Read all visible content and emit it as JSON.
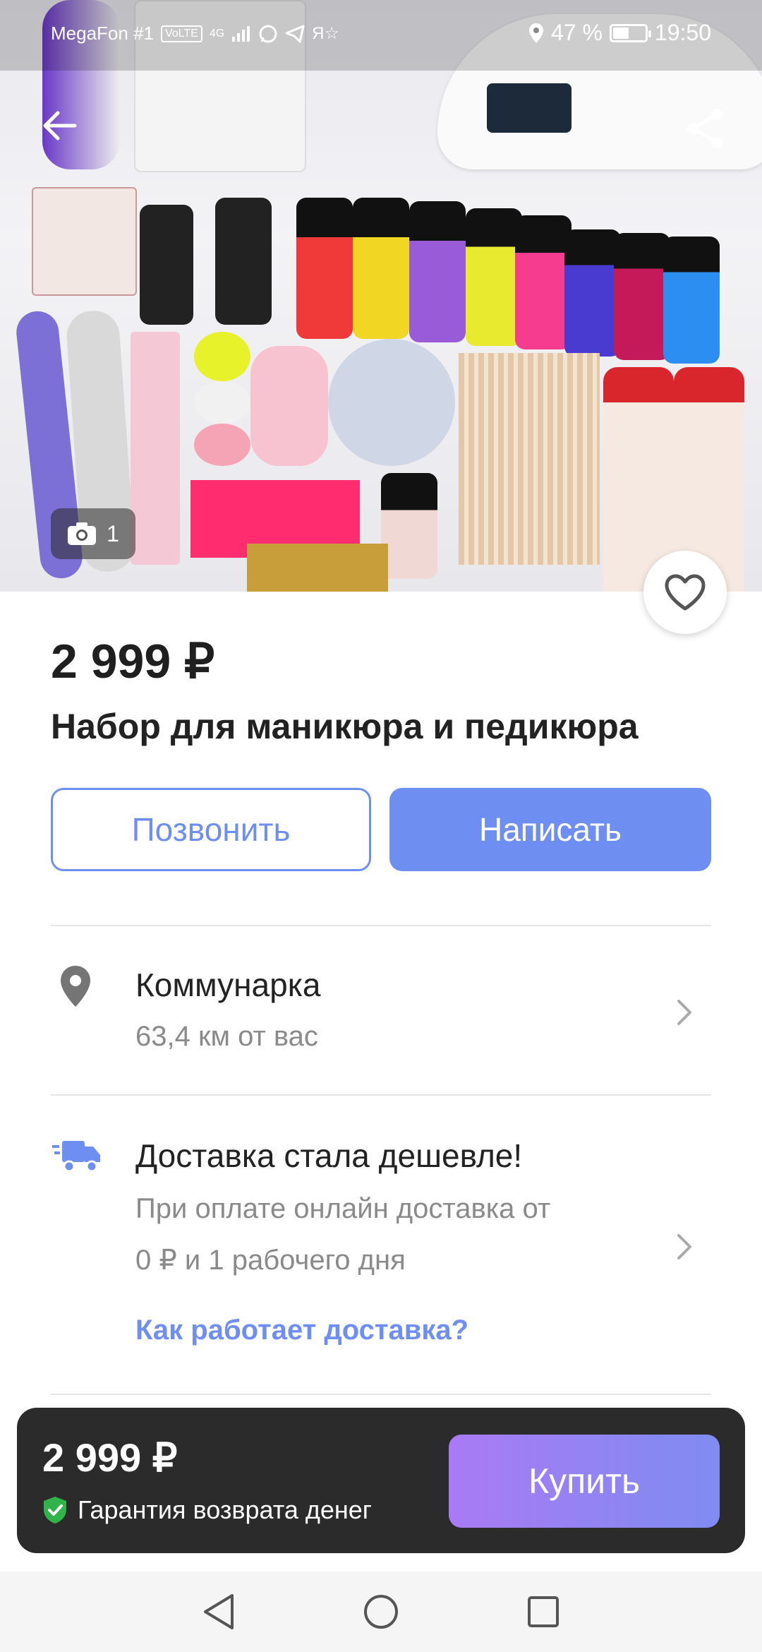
{
  "status_bar": {
    "carrier": "MegaFon #1",
    "volte": "VoLTE",
    "network": "4G",
    "battery_percent": "47 %",
    "battery_level": 0.47,
    "time": "19:50"
  },
  "photo": {
    "count": "1"
  },
  "listing": {
    "price": "2 999 ₽",
    "title": "Набор для маникюра и педикюра"
  },
  "actions": {
    "call_label": "Позвонить",
    "write_label": "Написать"
  },
  "location": {
    "name": "Коммунарка",
    "distance": "63,4 км от вас"
  },
  "delivery": {
    "title": "Доставка стала дешевле!",
    "line1": "При оплате онлайн доставка от",
    "line2": "0 ₽ и 1 рабочего дня",
    "link": "Как работает доставка?"
  },
  "buy_bar": {
    "price": "2 999 ₽",
    "guarantee": "Гарантия возврата денег",
    "buy_label": "Купить"
  },
  "colors": {
    "accent": "#6f8ef2",
    "buy_gradient_start": "#a97af5",
    "buy_gradient_end": "#7f8cf1",
    "bar_bg": "#2b2b2b",
    "guarantee_green": "#2fb34a"
  },
  "icons": {
    "back": "arrow-left-icon",
    "share": "share-icon",
    "camera": "camera-icon",
    "favorite": "heart-icon",
    "location": "location-pin-icon",
    "delivery": "truck-icon",
    "chevron": "chevron-right-icon",
    "shield": "shield-check-icon"
  }
}
